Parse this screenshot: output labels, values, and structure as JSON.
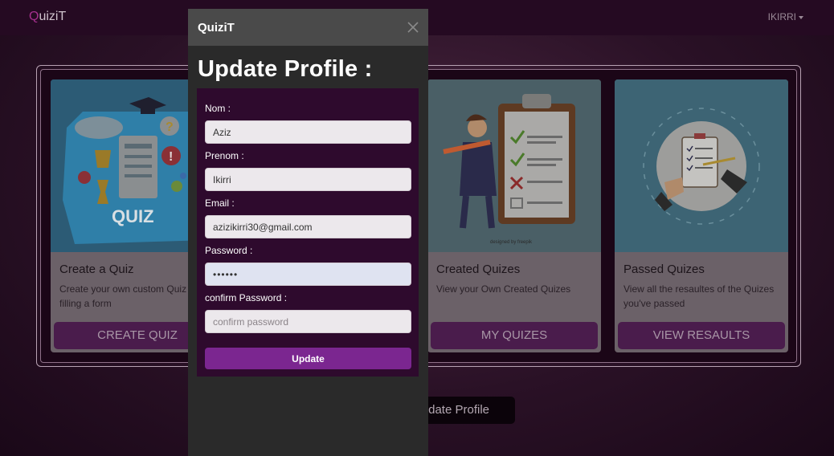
{
  "navbar": {
    "brand_q": "Q",
    "brand_rest": "uiziT",
    "user": "IKIRRI"
  },
  "cards": [
    {
      "title": "Create a Quiz",
      "desc": "Create your own custom Quiz by filling a form",
      "button": "CREATE QUIZ",
      "image_text": "QUIZ"
    },
    {
      "title": "Created Quizes",
      "desc": "View your Own Created Quizes",
      "button": "MY QUIZES"
    },
    {
      "title": "Passed Quizes",
      "desc": "View all the resaultes of the Quizes you've passed",
      "button": "VIEW RESAULTS"
    }
  ],
  "page_button": "Update Profile",
  "modal": {
    "title": "QuiziT",
    "heading": "Update Profile :",
    "fields": {
      "nom_label": "Nom :",
      "nom_value": "Aziz",
      "prenom_label": "Prenom :",
      "prenom_value": "Ikirri",
      "email_label": "Email :",
      "email_value": "azizikirri30@gmail.com",
      "password_label": "Password :",
      "password_value": "••••••",
      "confirm_label": "confirm Password :",
      "confirm_placeholder": "confirm password"
    },
    "submit_label": "Update"
  },
  "colors": {
    "navbar_bg": "#250a22",
    "modal_bg": "#2a2a2a",
    "modal_header_bg": "#4a4a4a",
    "form_panel_bg": "#2e0a2d",
    "submit_bg": "#7b2690",
    "card_button_bg": "#4a1c4c"
  },
  "icons": [
    "close-icon",
    "caret-down-icon"
  ]
}
